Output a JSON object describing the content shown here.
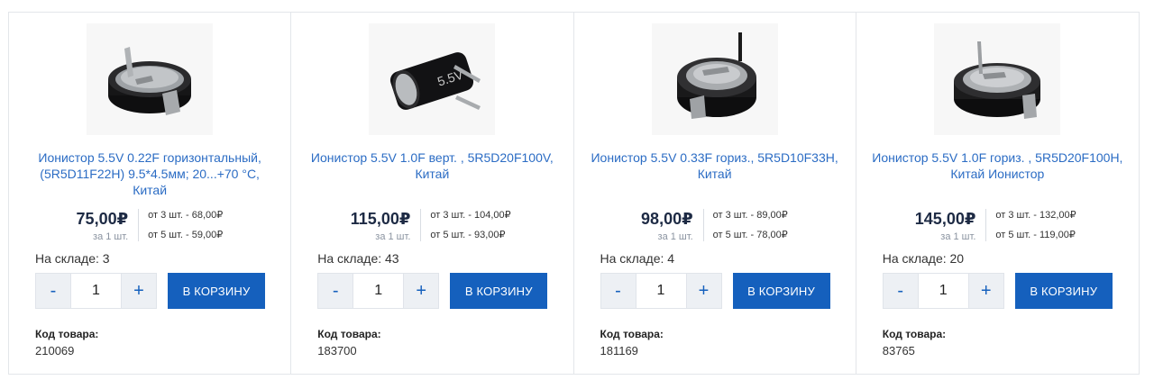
{
  "products": [
    {
      "title": "Ионистор 5.5V 0.22F горизонтальный, (5R5D11F22H) 9.5*4.5мм; 20...+70 °С, Китай",
      "price": "75,00₽",
      "unit": "за 1 шт.",
      "tier1": "от 3 шт. - 68,00₽",
      "tier2": "от 5 шт. - 59,00₽",
      "stock": "На складе: 3",
      "qty": "1",
      "minus": "-",
      "plus": "+",
      "cart": "В КОРЗИНУ",
      "code_label": "Код товара:",
      "code": "210069"
    },
    {
      "title": "Ионистор 5.5V 1.0F верт. , 5R5D20F100V, Китай",
      "price": "115,00₽",
      "unit": "за 1 шт.",
      "tier1": "от 3 шт. - 104,00₽",
      "tier2": "от 5 шт. - 93,00₽",
      "stock": "На складе: 43",
      "qty": "1",
      "minus": "-",
      "plus": "+",
      "cart": "В КОРЗИНУ",
      "code_label": "Код товара:",
      "code": "183700"
    },
    {
      "title": "Ионистор 5.5V 0.33F гориз., 5R5D10F33H, Китай",
      "price": "98,00₽",
      "unit": "за 1 шт.",
      "tier1": "от 3 шт. - 89,00₽",
      "tier2": "от 5 шт. - 78,00₽",
      "stock": "На складе: 4",
      "qty": "1",
      "minus": "-",
      "plus": "+",
      "cart": "В КОРЗИНУ",
      "code_label": "Код товара:",
      "code": "181169"
    },
    {
      "title": "Ионистор 5.5V 1.0F гориз. , 5R5D20F100H, Китай Ионистор",
      "price": "145,00₽",
      "unit": "за 1 шт.",
      "tier1": "от 3 шт. - 132,00₽",
      "tier2": "от 5 шт. - 119,00₽",
      "stock": "На складе: 20",
      "qty": "1",
      "minus": "-",
      "plus": "+",
      "cart": "В КОРЗИНУ",
      "code_label": "Код товара:",
      "code": "83765"
    }
  ],
  "colors": {
    "link": "#2b6cc4",
    "button": "#1560bd",
    "price": "#1d2a44"
  }
}
